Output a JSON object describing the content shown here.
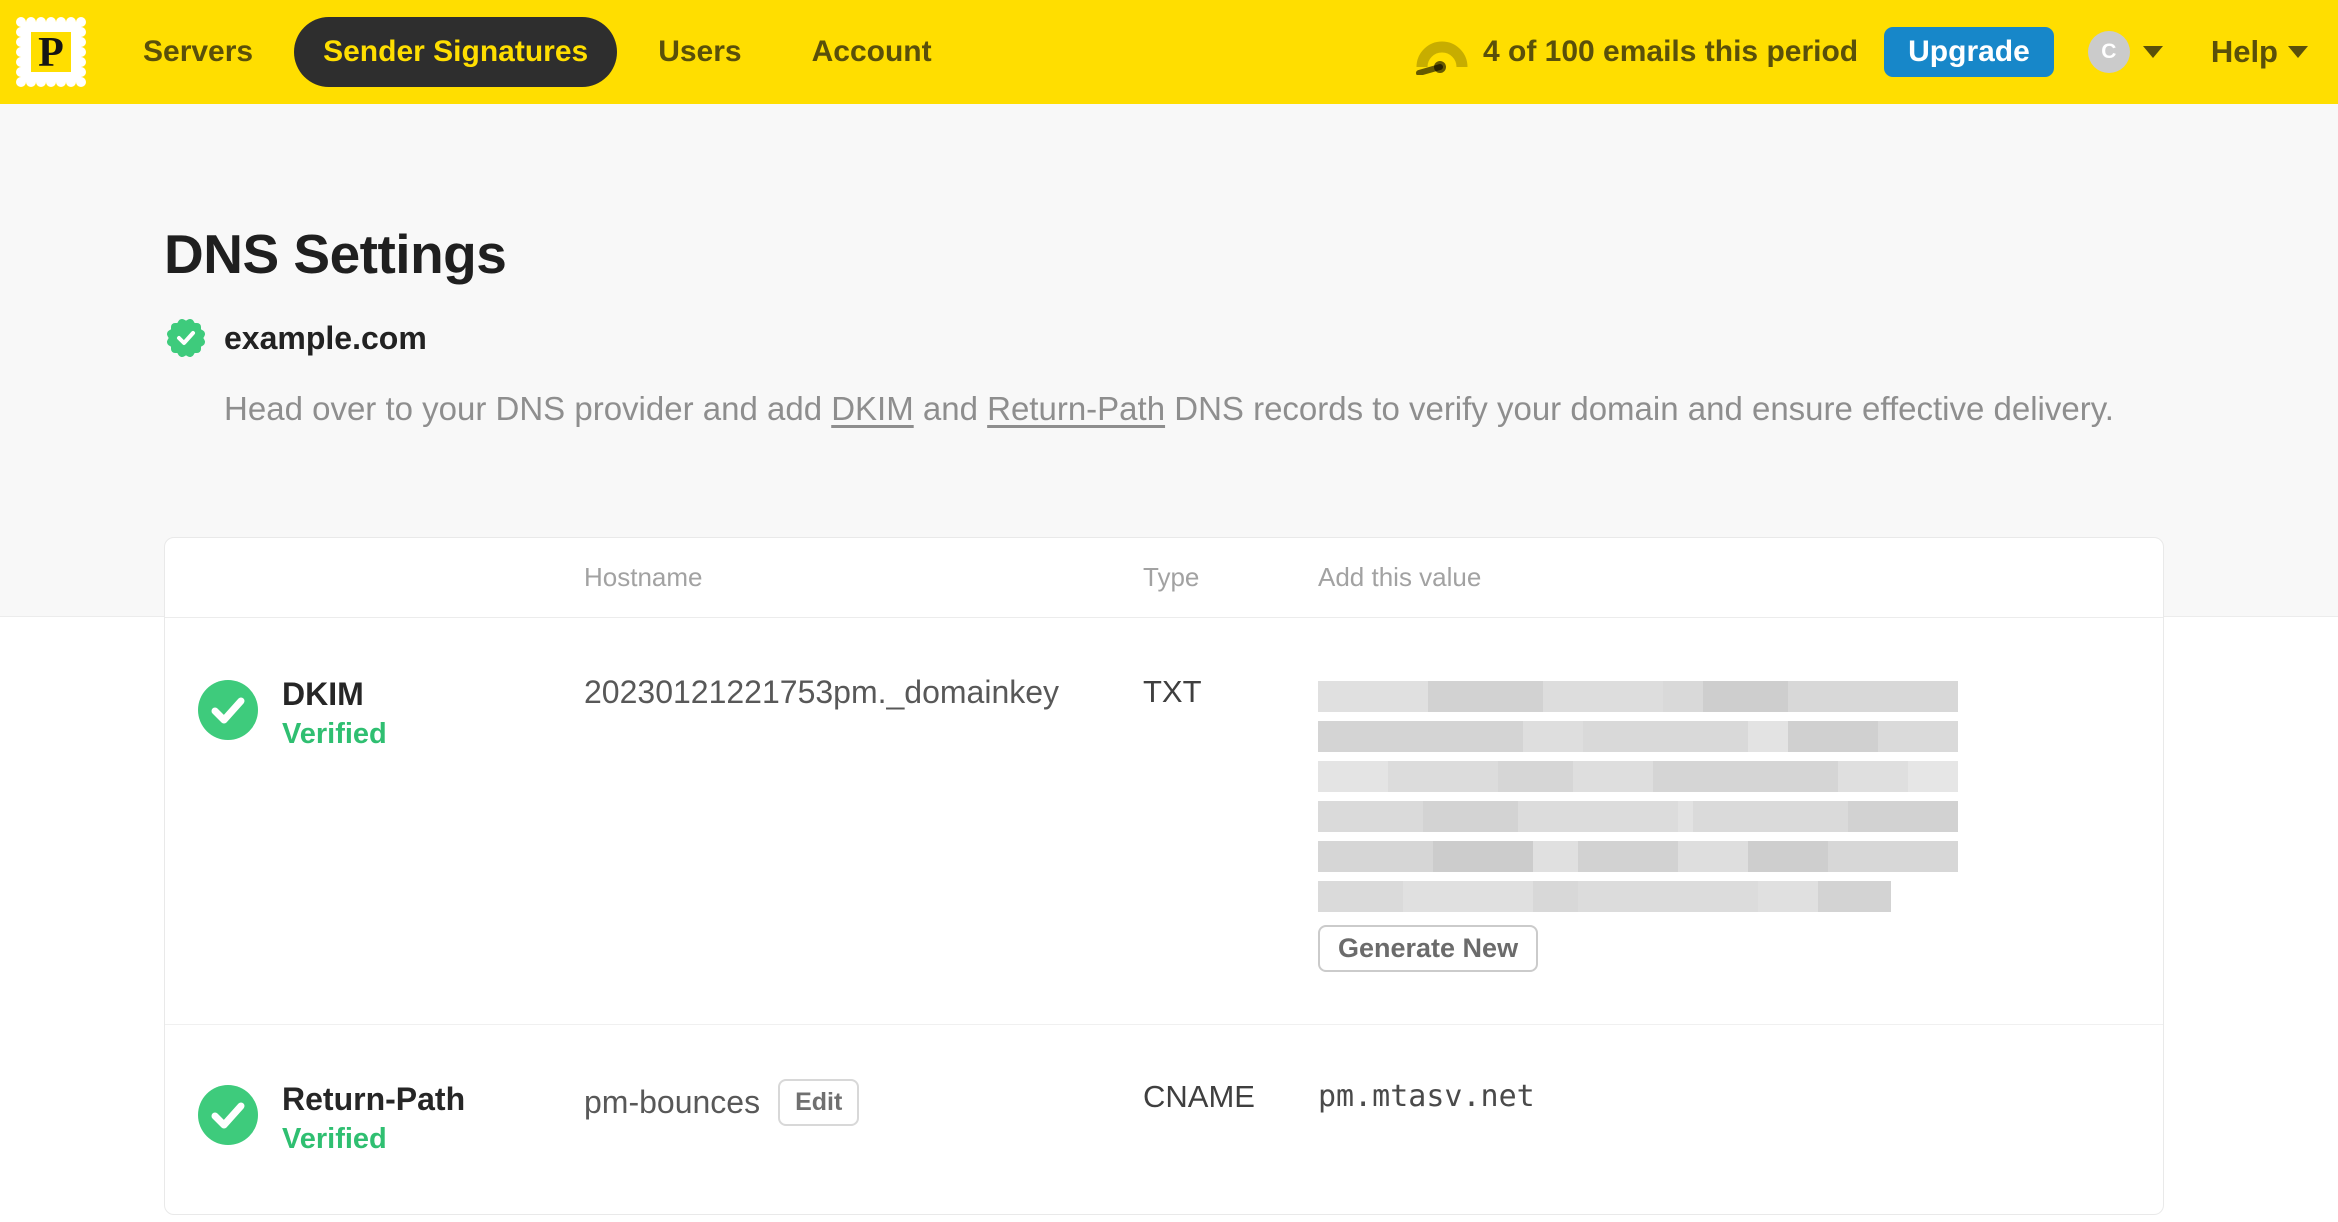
{
  "nav": {
    "logo_letter": "P",
    "items": [
      {
        "label": "Servers",
        "active": false
      },
      {
        "label": "Sender Signatures",
        "active": true
      },
      {
        "label": "Users",
        "active": false
      },
      {
        "label": "Account",
        "active": false
      }
    ],
    "usage_text": "4 of 100 emails this period",
    "upgrade_label": "Upgrade",
    "avatar_initial": "C",
    "help_label": "Help"
  },
  "page": {
    "title": "DNS Settings",
    "domain": "example.com",
    "desc": {
      "part1": "Head over to your DNS provider and add ",
      "link_dkim": "DKIM",
      "part2": " and ",
      "link_return_path": "Return-Path",
      "part3": " DNS records to verify your domain and ensure effective delivery."
    }
  },
  "table": {
    "headers": {
      "hostname": "Hostname",
      "type": "Type",
      "value": "Add this value"
    },
    "rows": [
      {
        "name": "DKIM",
        "status": "Verified",
        "hostname": "20230121221753pm._domainkey",
        "type": "TXT",
        "value_redacted": true,
        "action_label": "Generate New"
      },
      {
        "name": "Return-Path",
        "status": "Verified",
        "hostname": "pm-bounces",
        "edit_label": "Edit",
        "type": "CNAME",
        "value": "pm.mtasv.net"
      }
    ]
  },
  "colors": {
    "brand_yellow": "#FFDE00",
    "nav_text": "#5a500a",
    "accent_blue": "#1787C9",
    "success_green": "#3ECB7C",
    "page_gray": "#f8f8f8"
  }
}
